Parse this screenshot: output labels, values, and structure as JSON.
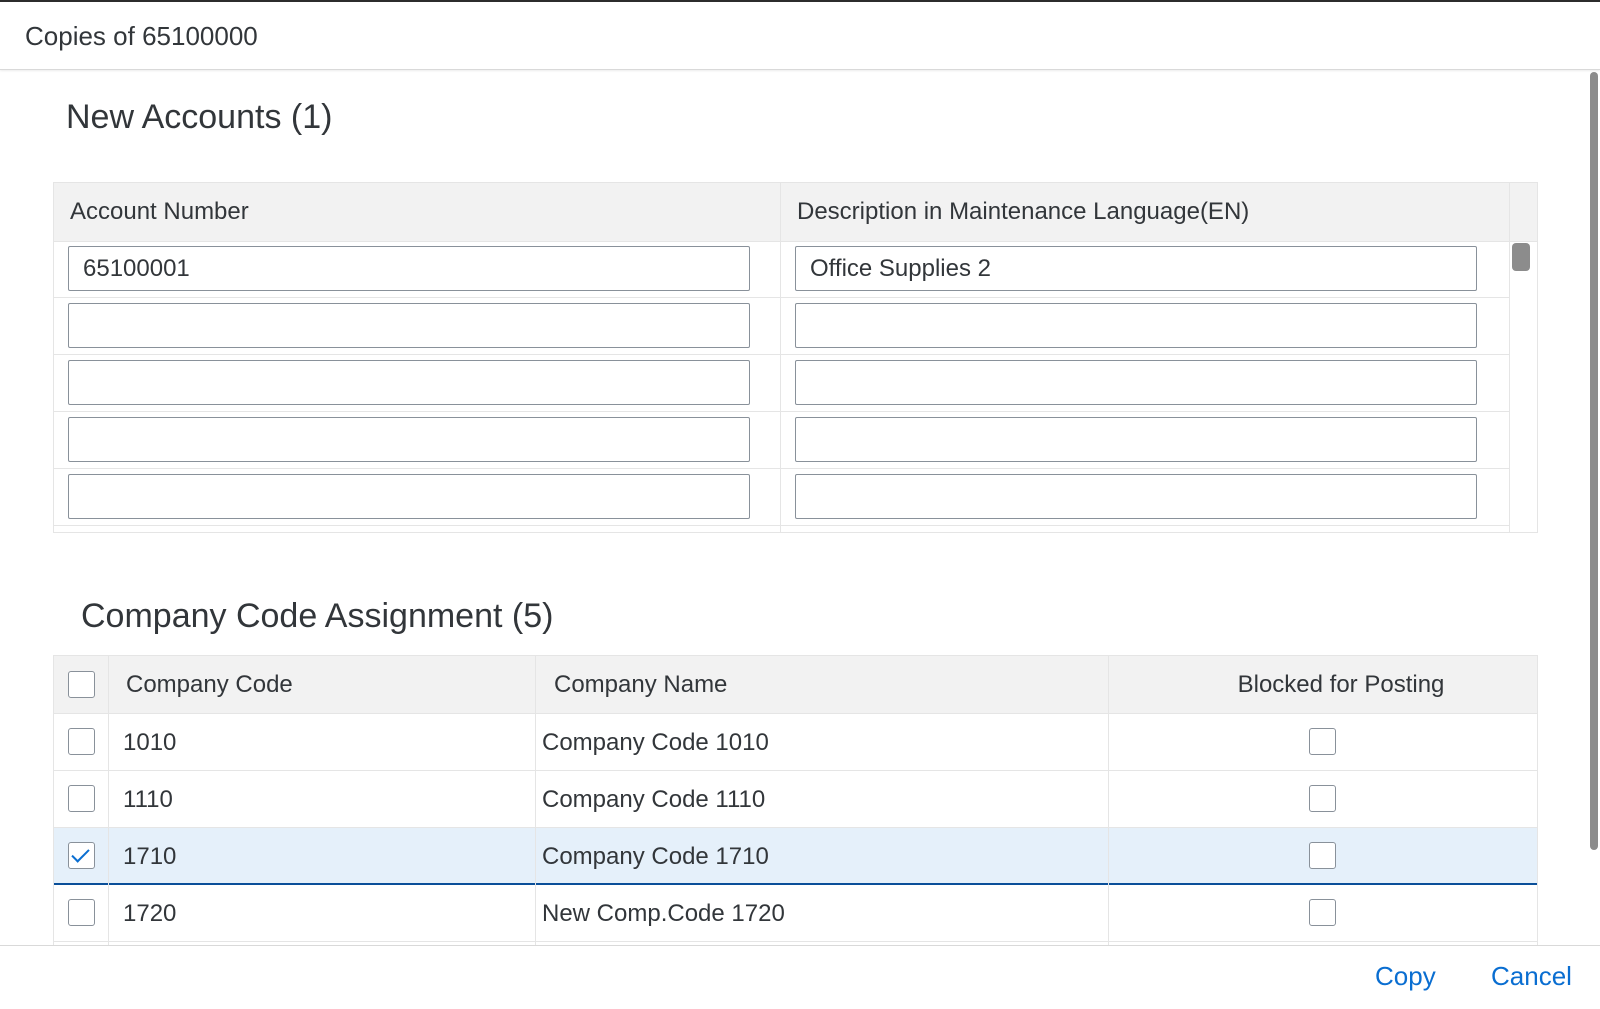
{
  "dialog": {
    "title": "Copies of 65100000"
  },
  "new_accounts": {
    "title": "New Accounts (1)",
    "columns": [
      "Account Number",
      "Description in Maintenance Language(EN)"
    ],
    "rows": [
      {
        "account_number": "65100001",
        "description": "Office Supplies 2"
      },
      {
        "account_number": "",
        "description": ""
      },
      {
        "account_number": "",
        "description": ""
      },
      {
        "account_number": "",
        "description": ""
      },
      {
        "account_number": "",
        "description": ""
      }
    ]
  },
  "company_codes": {
    "title": "Company Code Assignment (5)",
    "columns": [
      "Company Code",
      "Company Name",
      "Blocked for Posting"
    ],
    "select_all_checked": false,
    "rows": [
      {
        "code": "1010",
        "name": "Company Code 1010",
        "selected": false,
        "blocked": false
      },
      {
        "code": "1110",
        "name": "Company Code 1110",
        "selected": false,
        "blocked": false
      },
      {
        "code": "1710",
        "name": "Company Code 1710",
        "selected": true,
        "blocked": false
      },
      {
        "code": "1720",
        "name": "New Comp.Code 1720",
        "selected": false,
        "blocked": false
      }
    ]
  },
  "footer": {
    "copy_label": "Copy",
    "cancel_label": "Cancel"
  },
  "colors": {
    "accent": "#0a6ed1",
    "selected_row": "#e5f0fa",
    "header_bg": "#f2f2f2"
  }
}
